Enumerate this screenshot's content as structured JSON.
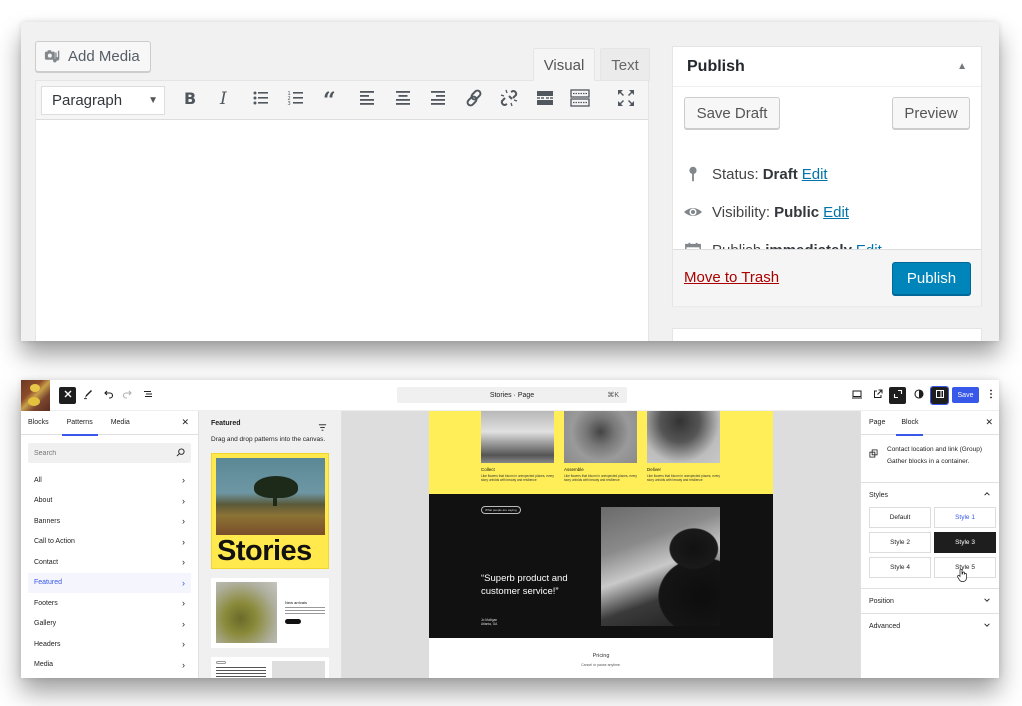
{
  "classic_editor": {
    "add_media_label": "Add Media",
    "tabs": [
      {
        "label": "Visual",
        "active": true
      },
      {
        "label": "Text",
        "active": false
      }
    ],
    "toolbar": {
      "format_select": "Paragraph",
      "buttons": [
        {
          "name": "bold",
          "icon": "bold-icon"
        },
        {
          "name": "italic",
          "icon": "italic-icon"
        },
        {
          "name": "bulleted-list",
          "icon": "bulleted-list-icon"
        },
        {
          "name": "numbered-list",
          "icon": "numbered-list-icon"
        },
        {
          "name": "blockquote",
          "icon": "blockquote-icon"
        },
        {
          "name": "align-left",
          "icon": "align-left-icon"
        },
        {
          "name": "align-center",
          "icon": "align-center-icon"
        },
        {
          "name": "align-right",
          "icon": "align-right-icon"
        },
        {
          "name": "insert-link",
          "icon": "link-icon"
        },
        {
          "name": "remove-link",
          "icon": "unlink-icon"
        },
        {
          "name": "read-more",
          "icon": "read-more-icon"
        },
        {
          "name": "toolbar-toggle",
          "icon": "keyboard-icon"
        },
        {
          "name": "fullscreen",
          "icon": "fullscreen-icon"
        }
      ]
    },
    "content": "",
    "publish_box": {
      "title": "Publish",
      "save_draft_label": "Save Draft",
      "preview_label": "Preview",
      "status_label": "Status:",
      "status_value": "Draft",
      "visibility_label": "Visibility:",
      "visibility_value": "Public",
      "publish_label": "Publish",
      "publish_value": "immediately",
      "edit_link": "Edit",
      "trash_label": "Move to Trash",
      "publish_button_label": "Publish"
    },
    "colors": {
      "primary": "#0085ba",
      "link": "#0073aa",
      "danger": "#aa0000"
    }
  },
  "site_editor": {
    "document_title": "Stories · Page",
    "shortcut": "⌘K",
    "save_label": "Save",
    "inserter": {
      "tabs": [
        {
          "label": "Blocks",
          "active": false
        },
        {
          "label": "Patterns",
          "active": true
        },
        {
          "label": "Media",
          "active": false
        }
      ],
      "search_placeholder": "Search",
      "categories": [
        {
          "label": "All",
          "active": false
        },
        {
          "label": "About",
          "active": false
        },
        {
          "label": "Banners",
          "active": false
        },
        {
          "label": "Call to Action",
          "active": false
        },
        {
          "label": "Contact",
          "active": false
        },
        {
          "label": "Featured",
          "active": true
        },
        {
          "label": "Footers",
          "active": false
        },
        {
          "label": "Gallery",
          "active": false
        },
        {
          "label": "Headers",
          "active": false
        },
        {
          "label": "Media",
          "active": false
        }
      ]
    },
    "patterns_panel": {
      "title": "Featured",
      "description": "Drag and drop patterns into the canvas.",
      "pattern_1_title": "Stories",
      "pattern_2_heading": "New arrivals"
    },
    "canvas": {
      "features": [
        {
          "title": "Collect",
          "text": "Like flowers that bloom in unexpected places, every story unfolds with beauty and resilience"
        },
        {
          "title": "Assemble",
          "text": "Like flowers that bloom in unexpected places, every story unfolds with beauty and resilience"
        },
        {
          "title": "Deliver",
          "text": "Like flowers that bloom in unexpected places, every story unfolds with beauty and resilience"
        }
      ],
      "testimonial_pill": "What people are saying",
      "quote": "“Superb product and customer service!”",
      "cite_name": "Jo Mulligan",
      "cite_place": "Atlanta, GA",
      "pricing_title": "Pricing",
      "pricing_subtitle": "Cancel or pause anytime."
    },
    "settings": {
      "tabs": [
        {
          "label": "Page",
          "active": false
        },
        {
          "label": "Block",
          "active": true
        }
      ],
      "block_name": "Contact location and link (Group)",
      "block_description": "Gather blocks in a container.",
      "styles_title": "Styles",
      "styles": [
        {
          "label": "Default",
          "state": "normal"
        },
        {
          "label": "Style 1",
          "state": "hover"
        },
        {
          "label": "Style 2",
          "state": "normal"
        },
        {
          "label": "Style 3",
          "state": "selected"
        },
        {
          "label": "Style 4",
          "state": "normal"
        },
        {
          "label": "Style 5",
          "state": "normal"
        }
      ],
      "position_title": "Position",
      "advanced_title": "Advanced"
    },
    "colors": {
      "accent": "#3858e9",
      "dark": "#1e1e1e",
      "pattern_yellow": "#ffee58"
    }
  }
}
